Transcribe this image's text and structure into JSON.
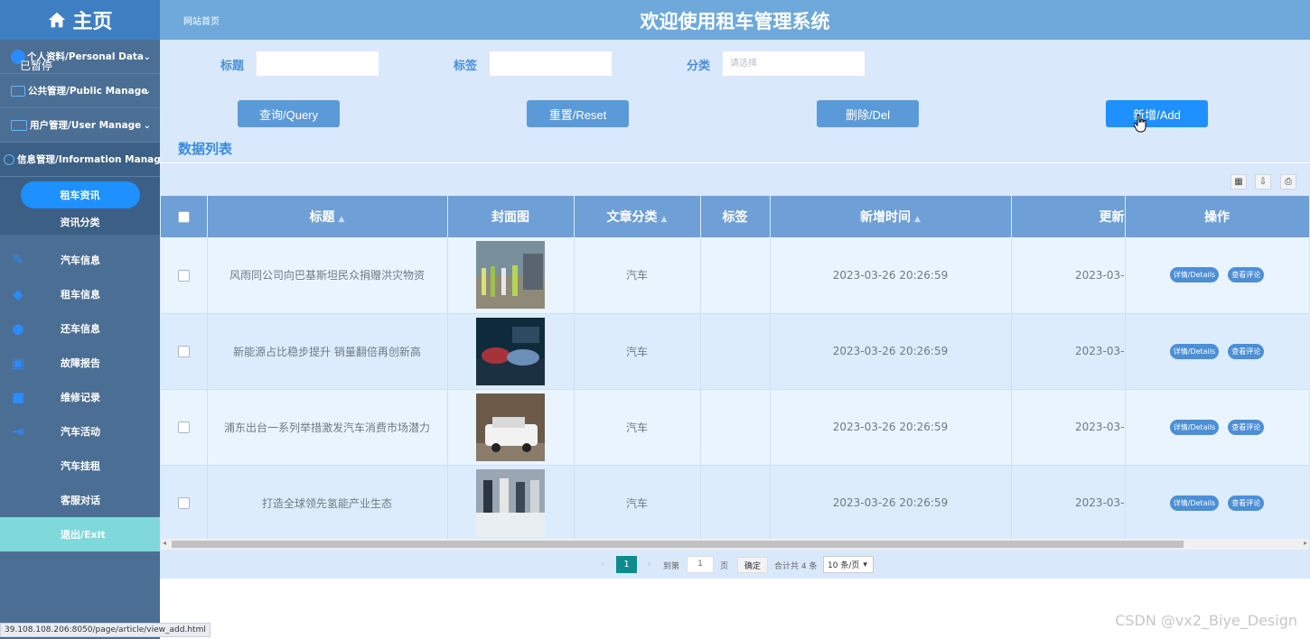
{
  "sidebar": {
    "logo": "主页",
    "paused_overlay": "已暂停",
    "groups": [
      {
        "label": "个人资料/Personal Data"
      },
      {
        "label": "公共管理/Public Manage"
      },
      {
        "label": "用户管理/User Manage"
      },
      {
        "label": "信息管理/Information Manage"
      }
    ],
    "sub_items": [
      {
        "label": "租车资讯"
      },
      {
        "label": "资讯分类"
      }
    ],
    "items": [
      {
        "label": "汽车信息"
      },
      {
        "label": "租车信息"
      },
      {
        "label": "还车信息"
      },
      {
        "label": "故障报告"
      },
      {
        "label": "维修记录"
      },
      {
        "label": "汽车活动"
      },
      {
        "label": "汽车挂租"
      },
      {
        "label": "客服对话"
      }
    ],
    "exit": "退出/Exit"
  },
  "header": {
    "breadcrumb": "网站首页",
    "title": "欢迎使用租车管理系统"
  },
  "search": {
    "title_label": "标题",
    "tag_label": "标签",
    "category_label": "分类",
    "category_placeholder": "请选择"
  },
  "buttons": {
    "query": "查询/Query",
    "reset": "重置/Reset",
    "delete": "删除/Del",
    "add": "新增/Add"
  },
  "list_title": "数据列表",
  "table": {
    "columns": [
      "标题",
      "封面图",
      "文章分类",
      "标签",
      "新增时间",
      "更新",
      "操作"
    ],
    "rows": [
      {
        "title": "风雨同公司向巴基斯坦民众捐赠洪灾物资",
        "category": "汽车",
        "tag": "",
        "created": "2023-03-26 20:26:59",
        "updated": "2023-03-"
      },
      {
        "title": "新能源占比稳步提升 销量翻倍再创新高",
        "category": "汽车",
        "tag": "",
        "created": "2023-03-26 20:26:59",
        "updated": "2023-03-"
      },
      {
        "title": "浦东出台一系列举措激发汽车消费市场潜力",
        "category": "汽车",
        "tag": "",
        "created": "2023-03-26 20:26:59",
        "updated": "2023-03-"
      },
      {
        "title": "打造全球领先氢能产业生态",
        "category": "汽车",
        "tag": "",
        "created": "2023-03-26 20:26:59",
        "updated": "2023-03-"
      }
    ],
    "actions": {
      "details": "详情/Details",
      "comments": "查看评论"
    }
  },
  "pager": {
    "current_page": "1",
    "goto_label": "到第",
    "goto_value": "1",
    "page_unit": "页",
    "confirm": "确定",
    "total": "合计共 4 条",
    "page_size": "10 条/页"
  },
  "status_url": "39.108.108.206:8050/page/article/view_add.html",
  "watermark": "CSDN @vx2_Biye_Design",
  "colors": {
    "sidebar_bg": "#4b6e94",
    "header_bg": "#6fa9db",
    "main_bg": "#d9e8fb",
    "accent": "#1e90ff",
    "table_header": "#6e9fd6"
  }
}
